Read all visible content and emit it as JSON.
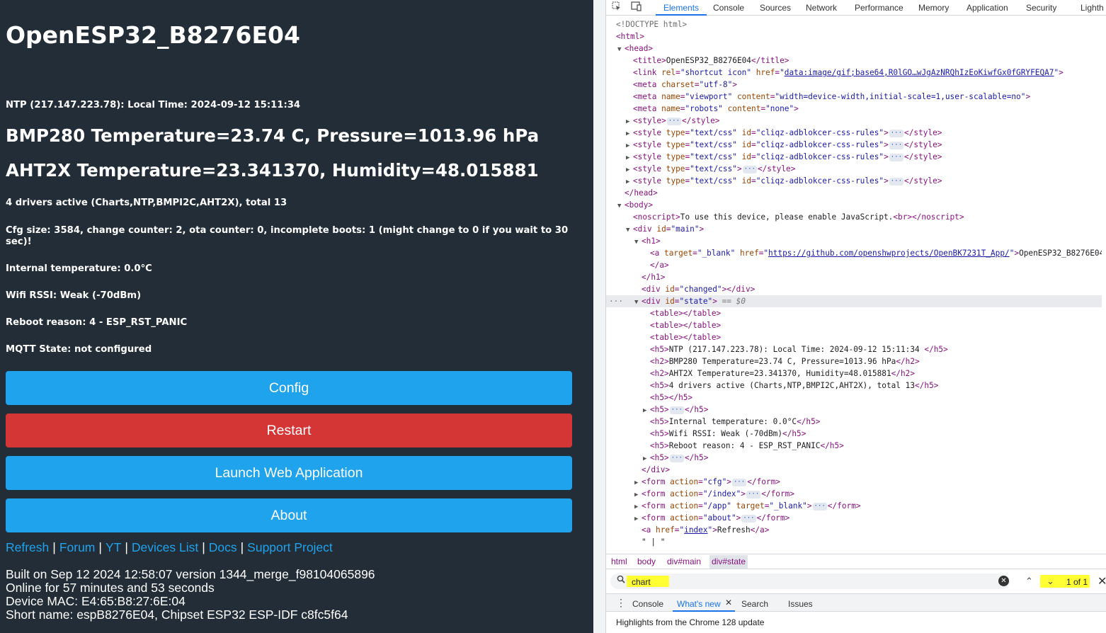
{
  "page": {
    "title": "OpenESP32_B8276E04",
    "ntp_line": "NTP (217.147.223.78): Local Time: 2024-09-12 15:11:34",
    "bmp_line": "BMP280 Temperature=23.74 C, Pressure=1013.96 hPa",
    "aht_line": "AHT2X Temperature=23.341370, Humidity=48.015881",
    "drivers_line": "4 drivers active (Charts,NTP,BMPI2C,AHT2X), total 13",
    "cfg_line": "Cfg size: 3584, change counter: 2, ota counter: 0, incomplete boots: 1 (might change to 0 if you wait to 30 sec)!",
    "internal_temp": "Internal temperature: 0.0°C",
    "wifi_rssi": "Wifi RSSI: Weak (-70dBm)",
    "reboot_reason": "Reboot reason: 4 - ESP_RST_PANIC",
    "mqtt_state": "MQTT State: not configured",
    "buttons": {
      "config": "Config",
      "restart": "Restart",
      "launch": "Launch Web Application",
      "about": "About"
    },
    "links": [
      "Refresh",
      "Forum",
      "YT",
      "Devices List",
      "Docs",
      "Support Project"
    ],
    "link_sep": "|",
    "footer": [
      "Built on Sep 12 2024 12:58:07 version 1344_merge_f98104065896",
      "Online for 57 minutes and 53 seconds",
      "Device MAC: E4:65:B8:27:6E:04",
      "Short name: espB8276E04, Chipset ESP32 ESP-IDF c8fc5f64"
    ],
    "colors": {
      "background": "#222d37",
      "button_blue": "#1fa3ec",
      "button_red": "#d43535",
      "link": "#1fa3ec"
    }
  },
  "devtools": {
    "toolbar_icons": [
      "inspect-element-icon",
      "device-toolbar-icon"
    ],
    "tabs": [
      "Elements",
      "Console",
      "Sources",
      "Network",
      "Performance",
      "Memory",
      "Application",
      "Security",
      "Lighth"
    ],
    "active_tab": "Elements",
    "breadcrumbs": [
      "html",
      "body",
      "div#main",
      "div#state"
    ],
    "search": {
      "value": "chart",
      "match_count": "1 of 1"
    },
    "drawer_tabs": [
      "Console",
      "What's new",
      "Search",
      "Issues"
    ],
    "active_drawer_tab": "What's new",
    "drawer_text": "Highlights from the Chrome 128 update",
    "selected_marker": "== $0",
    "tree": {
      "doctype": "<!DOCTYPE html>",
      "title_text": "OpenESP32_B8276E04",
      "shortcut_href": "data:image/gif;base64,R0lGO…wJgAzNRQhIzEoKiwfGx0fGRYFEQA7",
      "charset": "utf-8",
      "viewport": "width=device-width,initial-scale=1,user-scalable=no",
      "robots_name": "robots",
      "robots_content": "none",
      "css_type": "text/css",
      "adblock_id": "cliqz-adblokcer-css-rules",
      "noscript_text": "To use this device, please enable JavaScript.",
      "main_id": "main",
      "a_target": "_blank",
      "a_href": "https://github.com/openshwprojects/OpenBK7231T_App/",
      "a_text": "OpenESP32_B8276E04",
      "changed_id": "changed",
      "state_id": "state",
      "h5_ntp": "NTP (217.147.223.78): Local Time: 2024-09-12 15:11:34 ",
      "h2_bmp": "BMP280 Temperature=23.74 C, Pressure=1013.96 hPa",
      "h2_aht": "AHT2X Temperature=23.341370, Humidity=48.015881",
      "h5_drivers": "4 drivers active (Charts,NTP,BMPI2C,AHT2X), total 13",
      "h5_internal": "Internal temperature: 0.0°C",
      "h5_wifi": "Wifi RSSI: Weak (-70dBm)",
      "h5_reboot": "Reboot reason: 4 - ESP_RST_PANIC",
      "form_cfg": "cfg",
      "form_index": "/index",
      "form_app": "/app",
      "form_app_target": "_blank",
      "form_about": "about",
      "refresh_href": "index",
      "refresh_text": "Refresh",
      "pipe_text": "\" | \""
    }
  }
}
